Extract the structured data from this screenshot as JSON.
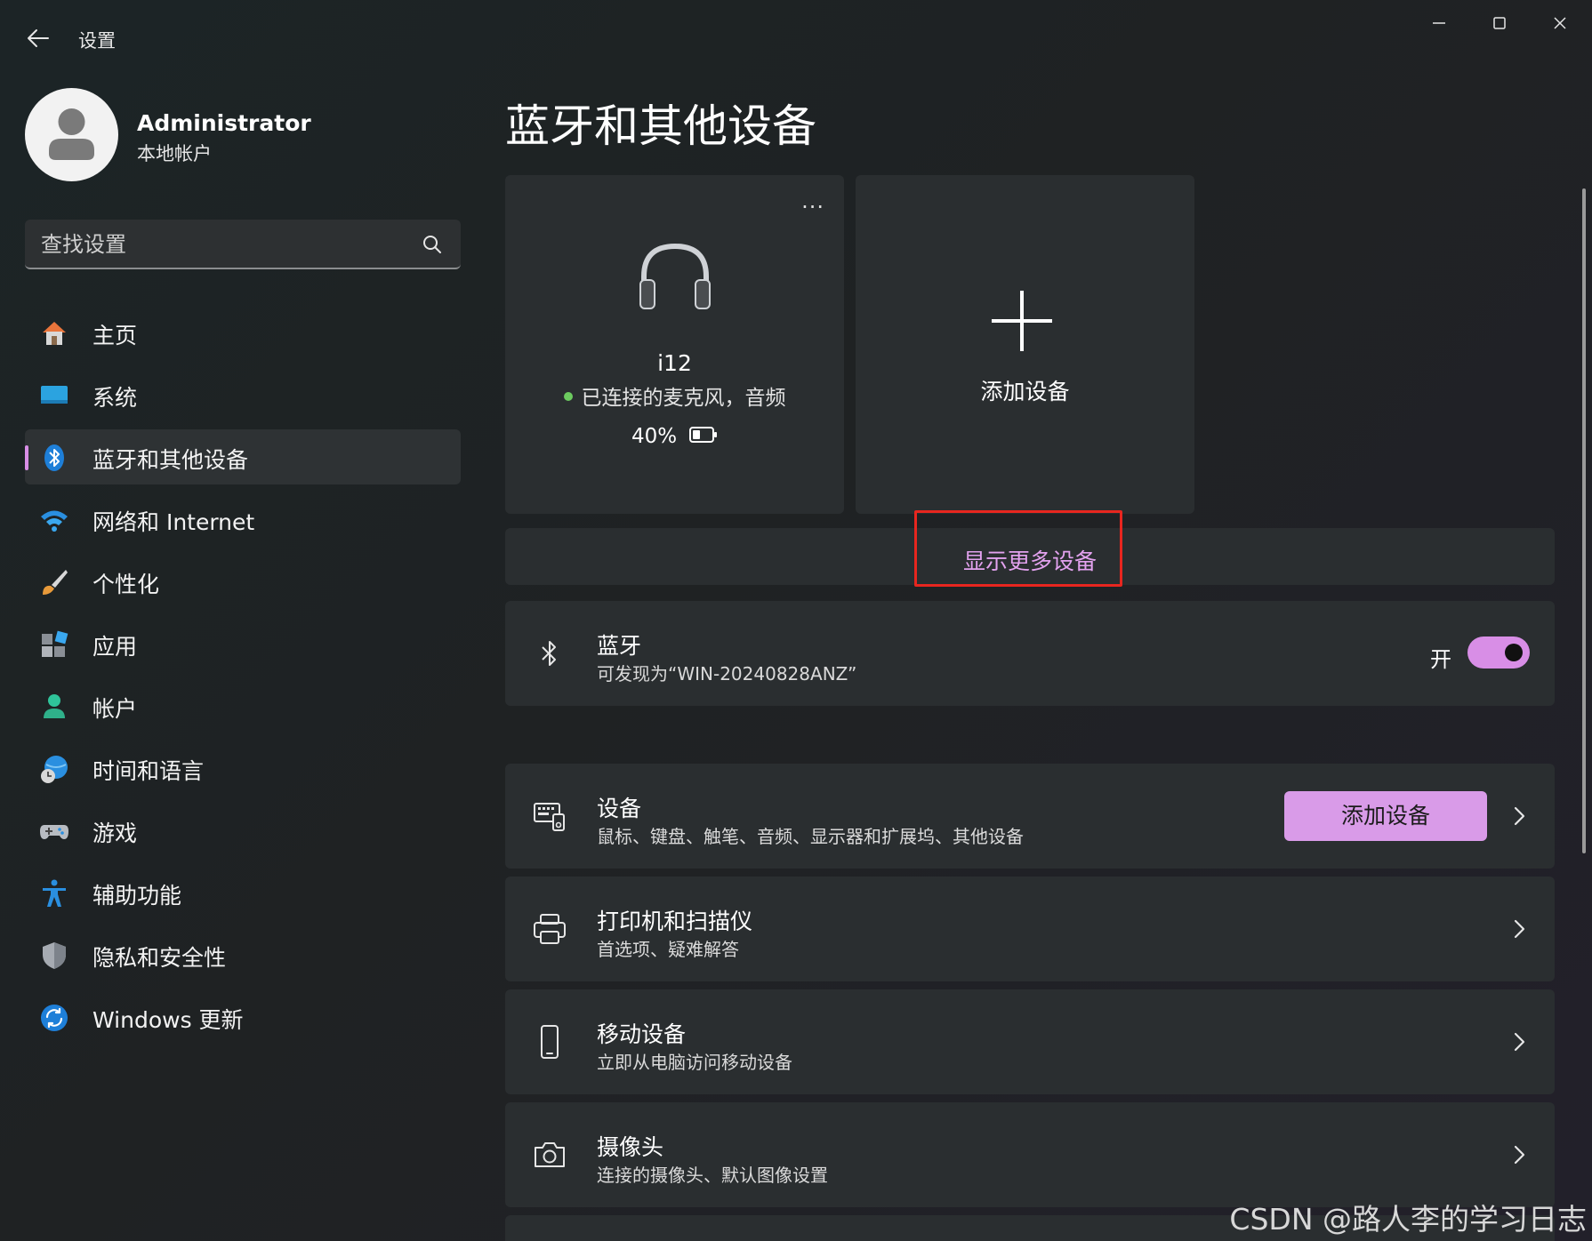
{
  "window": {
    "title": "设置"
  },
  "user": {
    "name": "Administrator",
    "type": "本地帐户"
  },
  "search": {
    "placeholder": "查找设置"
  },
  "sidebar": {
    "items": [
      {
        "label": "主页",
        "icon": "home-icon"
      },
      {
        "label": "系统",
        "icon": "monitor-icon"
      },
      {
        "label": "蓝牙和其他设备",
        "icon": "bluetooth-icon",
        "active": true
      },
      {
        "label": "网络和 Internet",
        "icon": "wifi-icon"
      },
      {
        "label": "个性化",
        "icon": "brush-icon"
      },
      {
        "label": "应用",
        "icon": "apps-icon"
      },
      {
        "label": "帐户",
        "icon": "person-icon"
      },
      {
        "label": "时间和语言",
        "icon": "globe-clock-icon"
      },
      {
        "label": "游戏",
        "icon": "gamepad-icon"
      },
      {
        "label": "辅助功能",
        "icon": "accessibility-icon"
      },
      {
        "label": "隐私和安全性",
        "icon": "shield-icon"
      },
      {
        "label": "Windows 更新",
        "icon": "update-icon"
      }
    ]
  },
  "main": {
    "title": "蓝牙和其他设备",
    "device_card": {
      "more": "···",
      "name": "i12",
      "status": "已连接的麦克风，音频",
      "battery": "40%",
      "battery_level": 0.4
    },
    "add_card": {
      "label": "添加设备"
    },
    "show_more": "显示更多设备",
    "bluetooth_row": {
      "title": "蓝牙",
      "subtitle": "可发现为“WIN-20240828ANZ”",
      "toggle_label": "开",
      "toggle_on": true
    },
    "devices_row": {
      "title": "设备",
      "subtitle": "鼠标、键盘、触笔、音频、显示器和扩展坞、其他设备",
      "button": "添加设备"
    },
    "printers_row": {
      "title": "打印机和扫描仪",
      "subtitle": "首选项、疑难解答"
    },
    "mobile_row": {
      "title": "移动设备",
      "subtitle": "立即从电脑访问移动设备"
    },
    "camera_row": {
      "title": "摄像头",
      "subtitle": "连接的摄像头、默认图像设置"
    }
  },
  "watermark": "CSDN @路人李的学习日志",
  "colors": {
    "accent": "#d88ee6",
    "highlight": "#e8261f",
    "link": "#e3a2ef"
  }
}
